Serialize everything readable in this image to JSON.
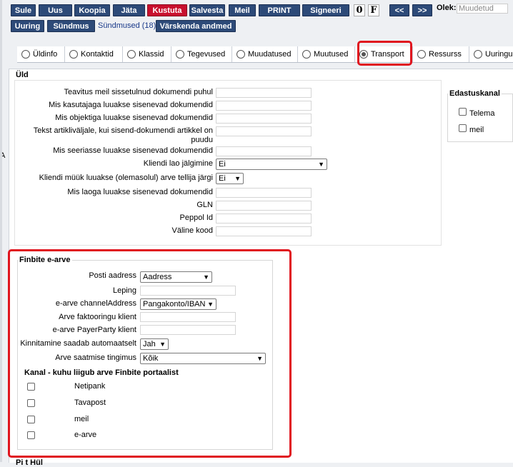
{
  "toolbar": {
    "buttons": [
      "Sule",
      "Uus",
      "Koopia",
      "Jäta",
      "Kustuta",
      "Salvesta",
      "Meil",
      "PRINT",
      "Signeeri"
    ],
    "attach_glyph": "0",
    "f_glyph": "F",
    "prev": "<<",
    "next": ">>",
    "state_label": "Olek:",
    "state_value": "Muudetud"
  },
  "toolbar2": {
    "uuring": "Uuring",
    "syndmus": "Sündmus",
    "syndmused_link": "Sündmused (18)",
    "varskenda": "Värskenda andmed"
  },
  "tabs": [
    "Üldinfo",
    "Kontaktid",
    "Klassid",
    "Tegevused",
    "Muudatused",
    "Muutused",
    "Transport",
    "Ressurss",
    "Uuringud"
  ],
  "active_tab": "Transport",
  "uld": {
    "title": "Üld",
    "rows": [
      "Teavitus meil sissetulnud dokumendi puhul",
      "Mis kasutajaga luuakse sisenevad dokumendid",
      "Mis objektiga luuakse sisenevad dokumendid",
      "Tekst artikliväljale, kui sisend-dokumendi artikkel on puudu",
      "Mis seeriasse luuakse sisenevad dokumendid",
      "Kliendi lao jälgimine",
      "Kliendi müük luuakse (olemasolul) arve tellija järgi",
      "Mis laoga luuakse sisenevad dokumendid",
      "GLN",
      "Peppol Id",
      "Väline kood"
    ],
    "kliendi_lao_value": "Ei",
    "kliendi_myyk_value": "Ei"
  },
  "edastuskanal": {
    "title": "Edastuskanal",
    "options": [
      "Telema",
      "meil"
    ]
  },
  "finbite": {
    "title": "Finbite e-arve",
    "posti_label": "Posti aadress",
    "posti_value": "Aadress",
    "leping_label": "Leping",
    "channel_label": "e-arve channelAddress",
    "channel_value": "Pangakonto/IBAN",
    "faktooring_label": "Arve faktooringu klient",
    "payer_label": "e-arve PayerParty klient",
    "kinnitamine_label": "Kinnitamine saadab automaatselt",
    "kinnitamine_value": "Jah",
    "tingimus_label": "Arve saatmise tingimus",
    "tingimus_value": "Kõik",
    "kanal_title": "Kanal - kuhu liigub arve Finbite portaalist",
    "kanal_options": [
      "Netipank",
      "Tavapost",
      "meil",
      "e-arve"
    ]
  },
  "bottom_partial": "Pi t Hül"
}
